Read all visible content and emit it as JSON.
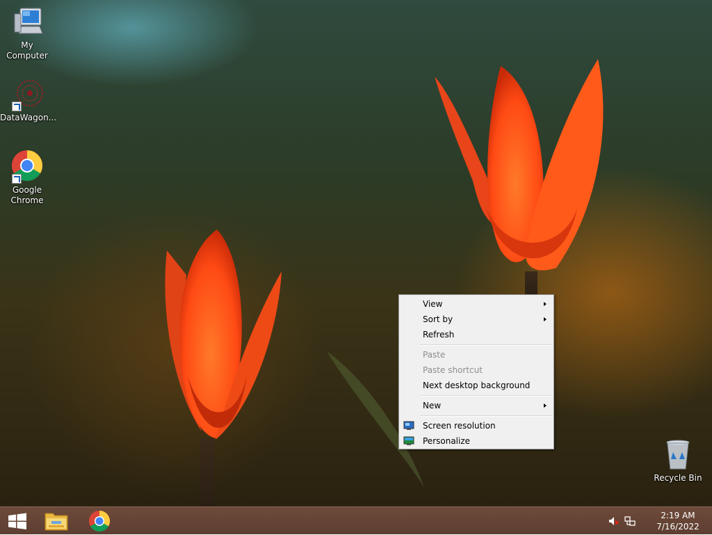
{
  "desktop": {
    "icons": [
      {
        "label": "My Computer",
        "icon": "computer-icon"
      },
      {
        "label": "DataWagon...",
        "icon": "datawagon-icon"
      },
      {
        "label": "Google Chrome",
        "icon": "chrome-icon"
      },
      {
        "label": "Recycle Bin",
        "icon": "recycle-bin-icon"
      }
    ]
  },
  "context_menu": {
    "items": [
      {
        "label": "View",
        "submenu": true,
        "enabled": true
      },
      {
        "label": "Sort by",
        "submenu": true,
        "enabled": true
      },
      {
        "label": "Refresh",
        "submenu": false,
        "enabled": true
      },
      {
        "label": "Paste",
        "submenu": false,
        "enabled": false
      },
      {
        "label": "Paste shortcut",
        "submenu": false,
        "enabled": false
      },
      {
        "label": "Next desktop background",
        "submenu": false,
        "enabled": true
      },
      {
        "label": "New",
        "submenu": true,
        "enabled": true
      },
      {
        "label": "Screen resolution",
        "submenu": false,
        "enabled": true,
        "icon": "screen-resolution-icon"
      },
      {
        "label": "Personalize",
        "submenu": false,
        "enabled": true,
        "icon": "personalize-icon"
      }
    ]
  },
  "taskbar": {
    "pinned": [
      "start-icon",
      "file-explorer-icon",
      "chrome-icon"
    ],
    "tray": [
      "volume-muted-icon",
      "network-icon"
    ],
    "clock": {
      "time": "2:19 AM",
      "date": "7/16/2022"
    }
  },
  "colors": {
    "taskbar": "#5d3e31",
    "menu_bg": "#f0f0f0",
    "menu_disabled": "#8d8d8d"
  }
}
